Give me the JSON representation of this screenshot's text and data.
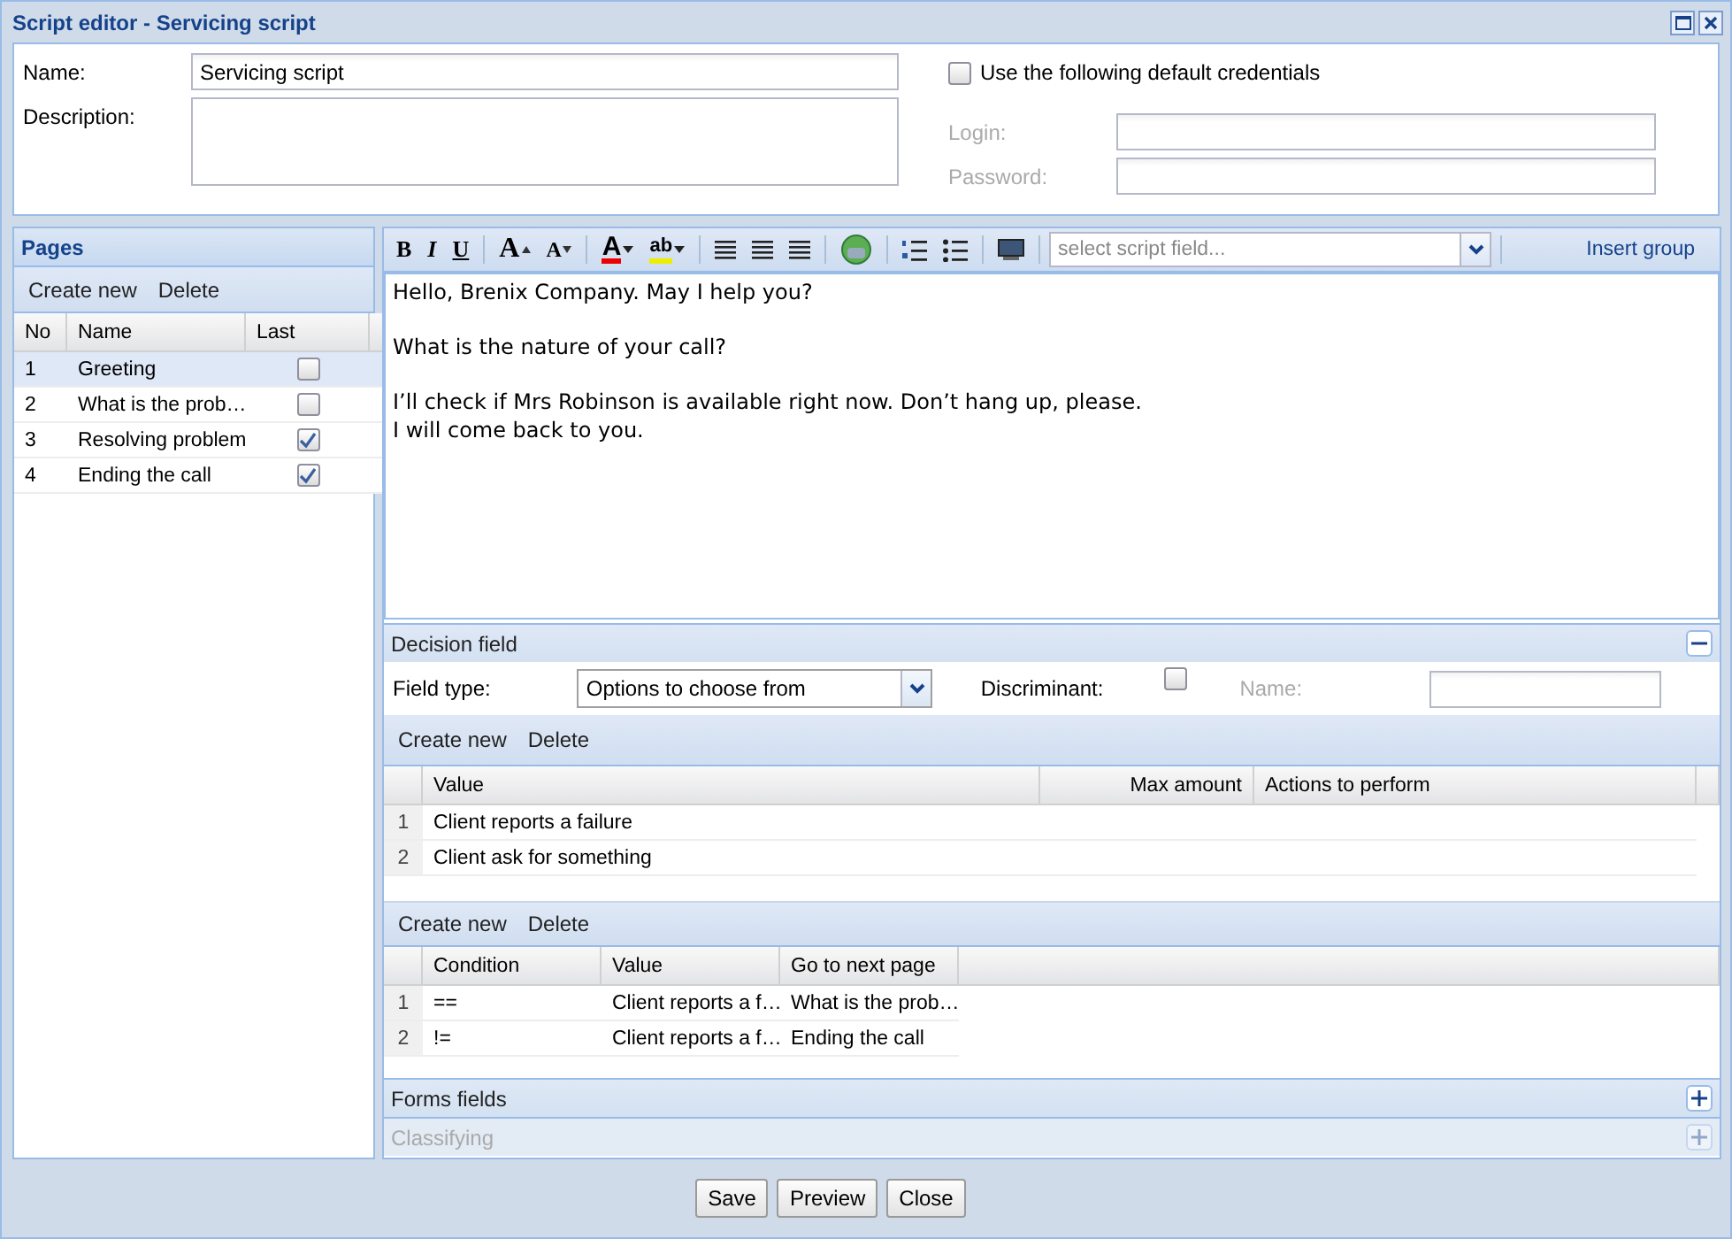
{
  "window": {
    "title": "Script editor - Servicing script"
  },
  "form": {
    "name_label": "Name:",
    "name_value": "Servicing script",
    "description_label": "Description:",
    "credentials_label": "Use the following default credentials",
    "credentials_checked": false,
    "login_label": "Login:",
    "password_label": "Password:"
  },
  "pages": {
    "title": "Pages",
    "actions": [
      "Create new",
      "Delete"
    ],
    "columns": [
      "No",
      "Name",
      "Last"
    ],
    "rows": [
      {
        "no": "1",
        "name": "Greeting",
        "last": false,
        "selected": true
      },
      {
        "no": "2",
        "name": "What is the prob…",
        "last": false,
        "selected": false
      },
      {
        "no": "3",
        "name": "Resolving problem",
        "last": true,
        "selected": false
      },
      {
        "no": "4",
        "name": "Ending the call",
        "last": true,
        "selected": false
      }
    ]
  },
  "toolbar": {
    "format_buttons": [
      "B",
      "I",
      "U"
    ],
    "size_buttons": [
      "A",
      "A"
    ],
    "color_buttons": [
      "A",
      "ab"
    ],
    "field_placeholder": "select script field...",
    "insert_label": "Insert group"
  },
  "editor_paragraphs": [
    [
      "Hello, Brenix Company. May I help you?"
    ],
    [
      "What is the nature of your call?"
    ],
    [
      "I’ll check if Mrs Robinson is available right now. Don’t hang up, please.",
      "I will come back to you."
    ]
  ],
  "decision": {
    "title": "Decision field",
    "expanded": true,
    "field_type_label": "Field type:",
    "field_type_value": "Options to choose from",
    "discriminant_label": "Discriminant:",
    "discriminant_checked": false,
    "name_label": "Name:",
    "values_actions": [
      "Create new",
      "Delete"
    ],
    "values_columns": [
      "Value",
      "Max amount",
      "Actions to perform"
    ],
    "values_rows": [
      {
        "no": "1",
        "value": "Client reports a failure"
      },
      {
        "no": "2",
        "value": "Client ask for something"
      }
    ],
    "conditions_actions": [
      "Create new",
      "Delete"
    ],
    "conditions_columns": [
      "Condition",
      "Value",
      "Go to next page"
    ],
    "conditions_rows": [
      {
        "no": "1",
        "condition": "==",
        "value": "Client reports a f…",
        "next": "What is the prob…"
      },
      {
        "no": "2",
        "condition": "!=",
        "value": "Client reports a f…",
        "next": "Ending the call"
      }
    ]
  },
  "sections": [
    {
      "title": "Forms fields",
      "disabled": false,
      "expanded": false
    },
    {
      "title": "Classifying",
      "disabled": true,
      "expanded": false
    }
  ],
  "buttons": [
    "Save",
    "Preview",
    "Close"
  ]
}
